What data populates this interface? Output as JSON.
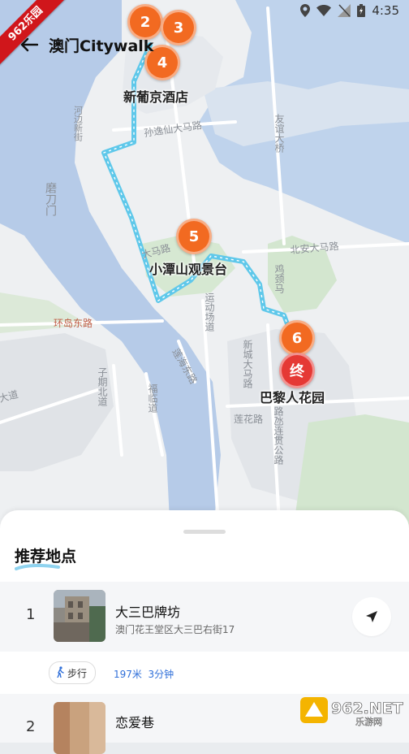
{
  "status": {
    "time": "4:35"
  },
  "watermark": {
    "ribbon": "962乐园",
    "site": "962.NET",
    "site_sub": "乐游网"
  },
  "header": {
    "title": "澳门Citywalk"
  },
  "map": {
    "roads": [
      "孙逸仙大马路",
      "友谊大桥",
      "河边新街",
      "磨刀门",
      "北安大马路",
      "环岛东路",
      "运动场道",
      "新城大马路",
      "鸡颈马",
      "子期北道",
      "福临道",
      "莲花路",
      "莲海东路",
      "路氹连贯公路",
      "大马路",
      "大道"
    ],
    "markers": [
      {
        "id": "2",
        "label": "2"
      },
      {
        "id": "3",
        "label": "3"
      },
      {
        "id": "4",
        "label": "4"
      },
      {
        "id": "5",
        "label": "5"
      },
      {
        "id": "6",
        "label": "6"
      },
      {
        "id": "end",
        "label": "终"
      }
    ],
    "places": [
      "新葡京酒店",
      "小潭山观景台",
      "巴黎人花园"
    ],
    "colors": {
      "route": "#5fc8ea",
      "marker": "#f26a21",
      "end_marker": "#e53935",
      "water": "#b6cbe8"
    }
  },
  "sheet": {
    "title": "推荐地点",
    "items": [
      {
        "index": "1",
        "name": "大三巴牌坊",
        "address": "澳门花王堂区大三巴右街17",
        "mode": "步行",
        "distance": "197米",
        "duration": "3分钟"
      },
      {
        "index": "2",
        "name": "恋爱巷"
      }
    ]
  }
}
